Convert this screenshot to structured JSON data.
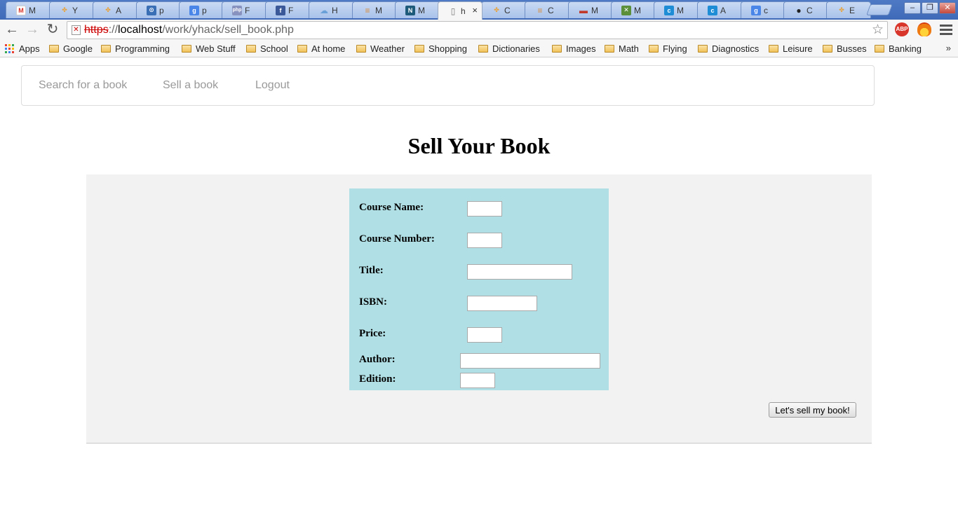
{
  "browser": {
    "tabs": [
      {
        "label": "M",
        "icon": "gmail-icon",
        "color": "#d93025",
        "glyph": "M"
      },
      {
        "label": "Y",
        "icon": "pinwheel-icon",
        "color": "#e8a23b",
        "glyph": "✤"
      },
      {
        "label": "A",
        "icon": "pinwheel-icon",
        "color": "#e8a23b",
        "glyph": "✤"
      },
      {
        "label": "p",
        "icon": "shield-icon",
        "color": "#3b6fb5",
        "glyph": "⊙"
      },
      {
        "label": "p",
        "icon": "google-icon",
        "color": "#4a86e8",
        "glyph": "g"
      },
      {
        "label": "F",
        "icon": "php-icon",
        "color": "#8892be",
        "glyph": "php"
      },
      {
        "label": "F",
        "icon": "facebook-icon",
        "color": "#3b5998",
        "glyph": "f"
      },
      {
        "label": "H",
        "icon": "cloud-icon",
        "color": "#6aa0d8",
        "glyph": "☁"
      },
      {
        "label": "M",
        "icon": "stackoverflow-icon",
        "color": "#d98c3c",
        "glyph": "≡"
      },
      {
        "label": "M",
        "icon": "mysql-icon",
        "color": "#1e5a7a",
        "glyph": "N"
      },
      {
        "label": "h",
        "icon": "page-icon",
        "color": "#ffffff",
        "glyph": "▯",
        "active": true
      },
      {
        "label": "C",
        "icon": "pinwheel-icon",
        "color": "#e8a23b",
        "glyph": "✤"
      },
      {
        "label": "C",
        "icon": "stackoverflow-icon",
        "color": "#d98c3c",
        "glyph": "≡"
      },
      {
        "label": "M",
        "icon": "flag-icon",
        "color": "#c0392b",
        "glyph": "▬"
      },
      {
        "label": "M",
        "icon": "map-icon",
        "color": "#5b8f3a",
        "glyph": "✕"
      },
      {
        "label": "M",
        "icon": "c-icon",
        "color": "#1f8dd6",
        "glyph": "c"
      },
      {
        "label": "A",
        "icon": "c-icon",
        "color": "#1f8dd6",
        "glyph": "c"
      },
      {
        "label": "c",
        "icon": "google-icon",
        "color": "#4a86e8",
        "glyph": "g"
      },
      {
        "label": "C",
        "icon": "github-icon",
        "color": "#222222",
        "glyph": "●"
      },
      {
        "label": "E",
        "icon": "pinwheel-icon",
        "color": "#e8a23b",
        "glyph": "✤"
      }
    ],
    "window_buttons": {
      "minimize": "–",
      "restore": "❐",
      "close": "✕"
    },
    "nav": {
      "back": "←",
      "forward": "→",
      "reload": "↻"
    },
    "address": {
      "scheme": "https",
      "separator": "://",
      "host": "localhost",
      "path": "/work/yhack/sell_book.php"
    },
    "star": "☆",
    "extensions": {
      "abp_label": "ABP"
    },
    "bookmarks": [
      "Apps",
      "Google",
      "Programming",
      "Web Stuff",
      "School",
      "At home",
      "Weather",
      "Shopping",
      "Dictionaries",
      "Images",
      "Math",
      "Flying",
      "Diagnostics",
      "Leisure",
      "Busses",
      "Banking"
    ],
    "bookmarks_more": "»"
  },
  "page": {
    "nav_links": [
      "Search for a book",
      "Sell a book",
      "Logout"
    ],
    "title": "Sell Your Book",
    "form": {
      "fields": [
        {
          "label": "Course Name:",
          "value": ""
        },
        {
          "label": "Course Number:",
          "value": ""
        },
        {
          "label": "Title:",
          "value": ""
        },
        {
          "label": "ISBN:",
          "value": ""
        },
        {
          "label": "Price:",
          "value": ""
        },
        {
          "label": "Author:",
          "value": ""
        },
        {
          "label": "Edition:",
          "value": ""
        }
      ],
      "submit_label": "Let's sell my book!"
    },
    "colors": {
      "form_background": "#b0dfe5",
      "well_background": "#f2f2f2",
      "nav_link": "#999999"
    }
  }
}
